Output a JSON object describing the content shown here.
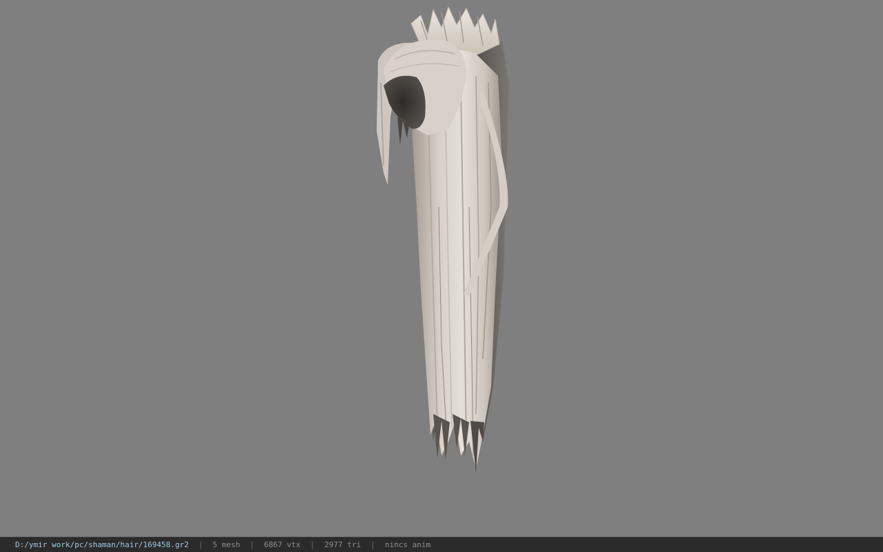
{
  "viewer": {
    "background_color": "#7f7f7f",
    "model_icon": "hair-mesh-model"
  },
  "status": {
    "file_path": "D:/ymir work/pc/shaman/hair/169458.gr2",
    "separator": "|",
    "mesh": "5 mesh",
    "vertices": "6867 vtx",
    "triangles": "2977 tri",
    "anim": "nincs anim"
  }
}
